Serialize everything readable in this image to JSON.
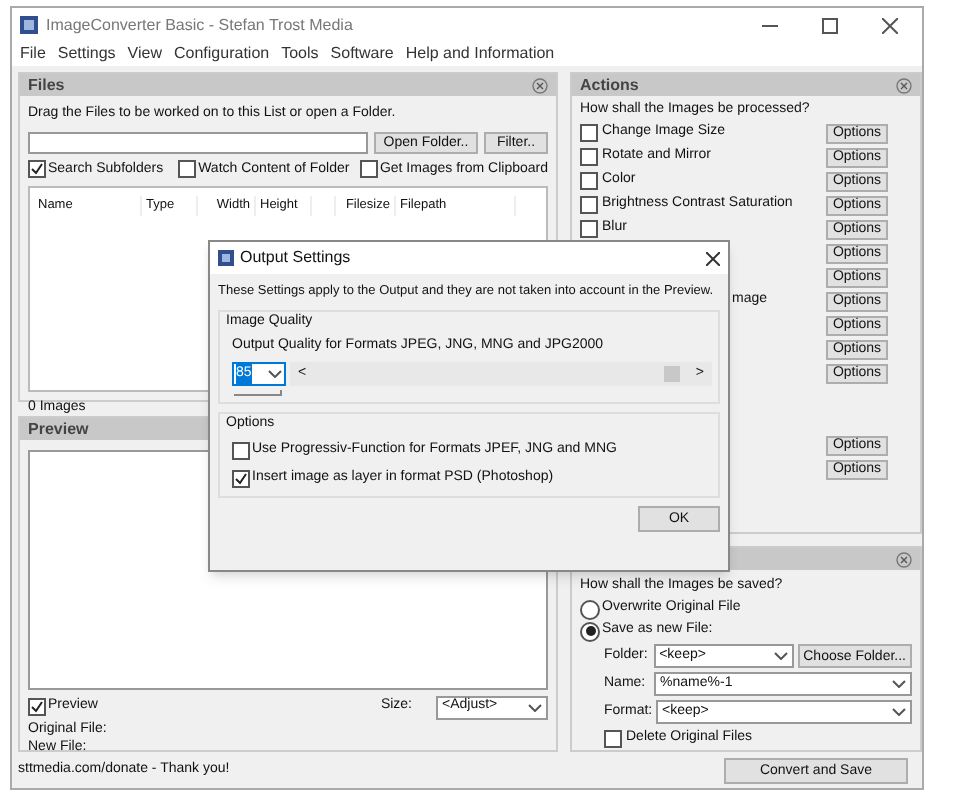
{
  "window": {
    "title": "ImageConverter Basic - Stefan Trost Media"
  },
  "menu": [
    "File",
    "Settings",
    "View",
    "Configuration",
    "Tools",
    "Software",
    "Help and Information"
  ],
  "files": {
    "title": "Files",
    "hint": "Drag the Files to be worked on to this List or open a Folder.",
    "buttons": [
      "Open Folder..",
      "Filter.."
    ],
    "checkboxes": [
      {
        "label": "Search Subfolders",
        "checked": true
      },
      {
        "label": "Watch Content of Folder",
        "checked": false
      },
      {
        "label": "Get Images from Clipboard",
        "checked": false
      }
    ],
    "columns": [
      "Name",
      "Type",
      "Width",
      "Height",
      "",
      "Filesize",
      "Filepath"
    ],
    "count": "0 Images"
  },
  "preview": {
    "title": "Preview",
    "checkbox": {
      "label": "Preview",
      "checked": true
    },
    "size_label": "Size:",
    "size_value": "<Adjust>",
    "original_label": "Original File:",
    "new_label": "New File:"
  },
  "actions": {
    "title": "Actions",
    "prompt": "How shall the Images be processed?",
    "items": [
      {
        "kind": "checkbox",
        "label": "Change Image Size",
        "checked": false,
        "button": "Options"
      },
      {
        "kind": "checkbox",
        "label": "Rotate and Mirror",
        "checked": false,
        "button": "Options"
      },
      {
        "kind": "checkbox",
        "label": "Color",
        "checked": false,
        "button": "Options"
      },
      {
        "kind": "checkbox",
        "label": "Brightness Contrast Saturation",
        "checked": false,
        "button": "Options"
      },
      {
        "kind": "checkbox",
        "label": "Blur",
        "checked": false,
        "button": "Options"
      },
      {
        "kind": "covered",
        "button": "Options"
      },
      {
        "kind": "covered",
        "button": "Options"
      },
      {
        "kind": "covered",
        "label": "mage",
        "button": "Options"
      },
      {
        "kind": "covered",
        "button": "Options"
      },
      {
        "kind": "covered",
        "button": "Options"
      },
      {
        "kind": "covered",
        "button": "Options"
      },
      {
        "kind": "gap"
      },
      {
        "kind": "gap"
      },
      {
        "kind": "covered",
        "button": "Options"
      },
      {
        "kind": "covered",
        "button": "Options"
      }
    ]
  },
  "save": {
    "prompt": "How shall the Images be saved?",
    "options": [
      {
        "label": "Overwrite Original File",
        "selected": false
      },
      {
        "label": "Save as new File:",
        "selected": true
      }
    ],
    "fields": [
      {
        "label": "Folder:",
        "value": "<keep>",
        "button": "Choose Folder..."
      },
      {
        "label": "Name:",
        "value": "%name%-1"
      },
      {
        "label": "Format:",
        "value": "<keep>"
      }
    ],
    "delete": {
      "label": "Delete Original Files",
      "checked": false
    }
  },
  "status": "sttmedia.com/donate - Thank you!",
  "convert_button": "Convert and Save",
  "dialog": {
    "title": "Output Settings",
    "note": "These Settings apply to the Output and they are not taken into account in the Preview.",
    "quality_group": "Image Quality",
    "quality_label": "Output Quality for Formats JPEG, JNG, MNG and JPG2000",
    "quality_value": "85",
    "scroll_left": "<",
    "scroll_right": ">",
    "level": 0.92,
    "options_group": "Options",
    "options": [
      {
        "label": "Use Progressiv-Function for Formats JPEF, JNG and MNG",
        "checked": false
      },
      {
        "label": "Insert image as layer in format PSD (Photoshop)",
        "checked": true
      }
    ],
    "ok": "OK"
  }
}
